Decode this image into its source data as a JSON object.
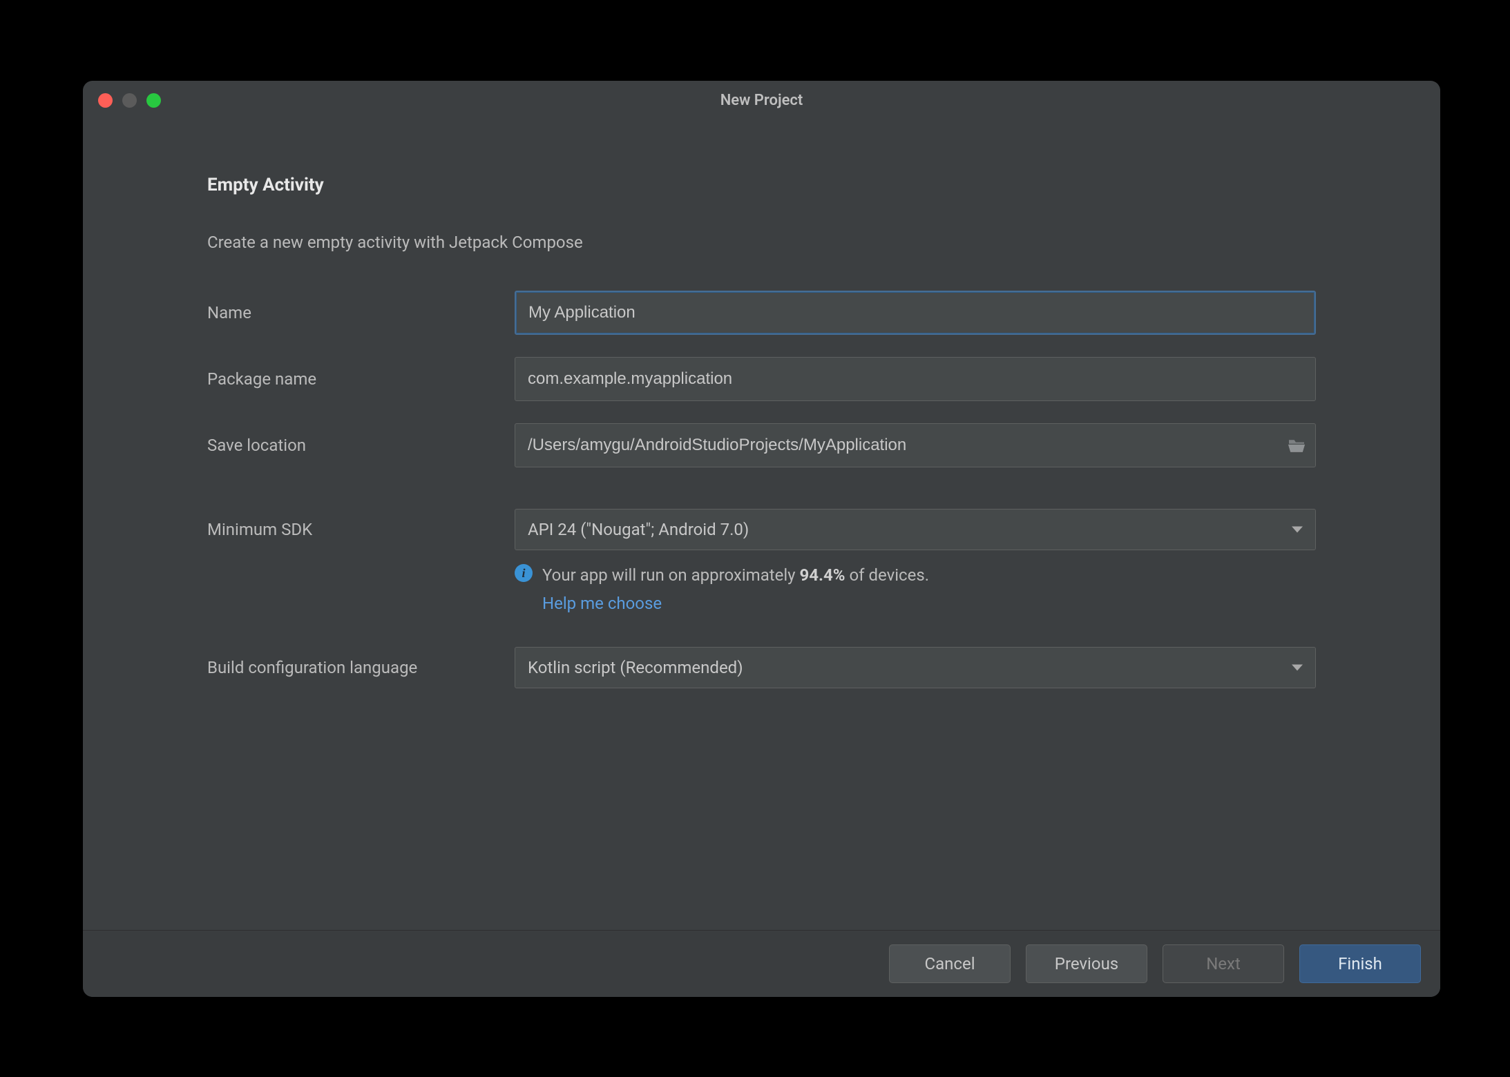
{
  "window": {
    "title": "New Project"
  },
  "page": {
    "heading": "Empty Activity",
    "subheading": "Create a new empty activity with Jetpack Compose"
  },
  "form": {
    "name_label": "Name",
    "name_value": "My Application",
    "package_label": "Package name",
    "package_value": "com.example.myapplication",
    "location_label": "Save location",
    "location_value": "/Users/amygu/AndroidStudioProjects/MyApplication",
    "min_sdk_label": "Minimum SDK",
    "min_sdk_value": "API 24 (\"Nougat\"; Android 7.0)",
    "build_lang_label": "Build configuration language",
    "build_lang_value": "Kotlin script (Recommended)"
  },
  "info": {
    "prefix": "Your app will run on approximately ",
    "percent": "94.4%",
    "suffix": " of devices.",
    "help_link": "Help me choose"
  },
  "footer": {
    "cancel": "Cancel",
    "previous": "Previous",
    "next": "Next",
    "finish": "Finish"
  }
}
